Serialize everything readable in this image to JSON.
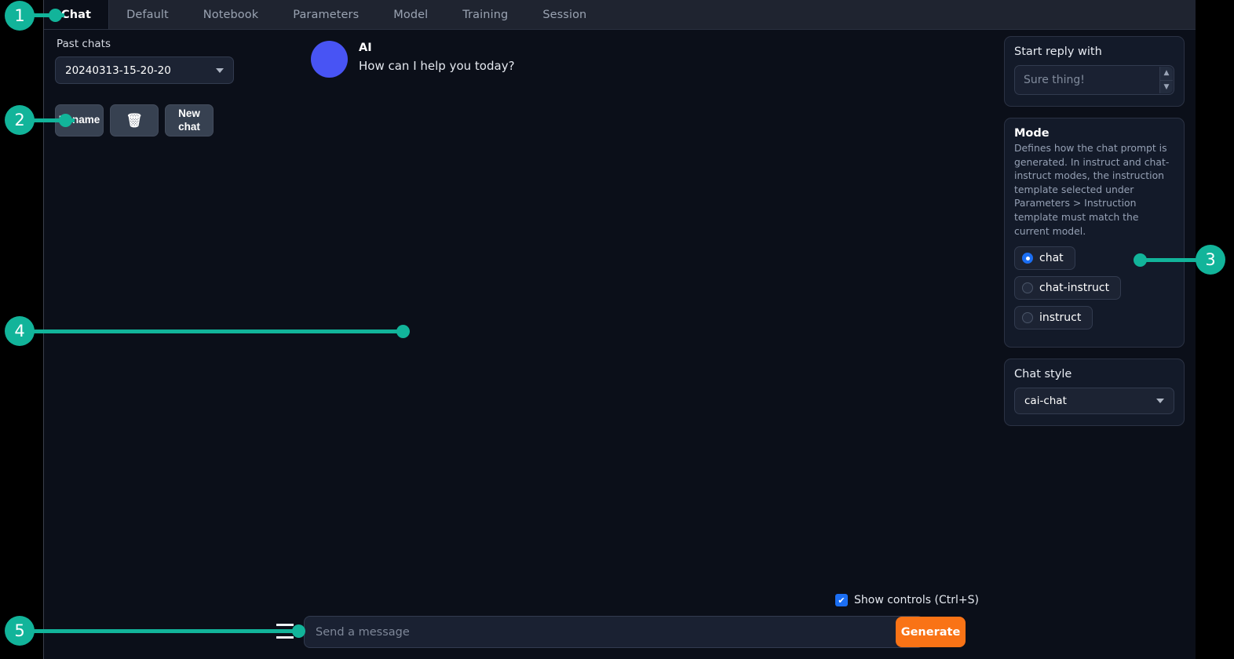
{
  "tabs": [
    {
      "label": "Chat",
      "active": true
    },
    {
      "label": "Default",
      "active": false
    },
    {
      "label": "Notebook",
      "active": false
    },
    {
      "label": "Parameters",
      "active": false
    },
    {
      "label": "Model",
      "active": false
    },
    {
      "label": "Training",
      "active": false
    },
    {
      "label": "Session",
      "active": false
    }
  ],
  "past_chats": {
    "label": "Past chats",
    "selected": "20240313-15-20-20",
    "rename_label": "Rename",
    "delete_icon": "wastebasket-icon",
    "delete_glyph": "🗑",
    "new_chat_label": "New chat"
  },
  "chat": {
    "messages": [
      {
        "name": "AI",
        "text": "How can I help you today?",
        "avatar_color": "#4854f4"
      }
    ]
  },
  "start_reply": {
    "title": "Start reply with",
    "placeholder": "Sure thing!",
    "value": ""
  },
  "mode": {
    "title": "Mode",
    "description": "Defines how the chat prompt is generated. In instruct and chat-instruct modes, the instruction template selected under Parameters > Instruction template must match the current model.",
    "options": [
      {
        "label": "chat",
        "checked": true
      },
      {
        "label": "chat-instruct",
        "checked": false
      },
      {
        "label": "instruct",
        "checked": false
      }
    ]
  },
  "chat_style": {
    "title": "Chat style",
    "selected": "cai-chat"
  },
  "show_controls": {
    "label": "Show controls (Ctrl+S)",
    "checked": true,
    "check_glyph": "✔"
  },
  "composer": {
    "placeholder": "Send a message"
  },
  "generate": {
    "label": "Generate",
    "color": "#f97316"
  },
  "annotations": [
    {
      "number": "1"
    },
    {
      "number": "2"
    },
    {
      "number": "3"
    },
    {
      "number": "4"
    },
    {
      "number": "5"
    }
  ],
  "theme": {
    "accent": "#12b49a",
    "background": "#0b0f19",
    "tabbar": "#1f2430",
    "radio_active": "#1b6ef3"
  }
}
